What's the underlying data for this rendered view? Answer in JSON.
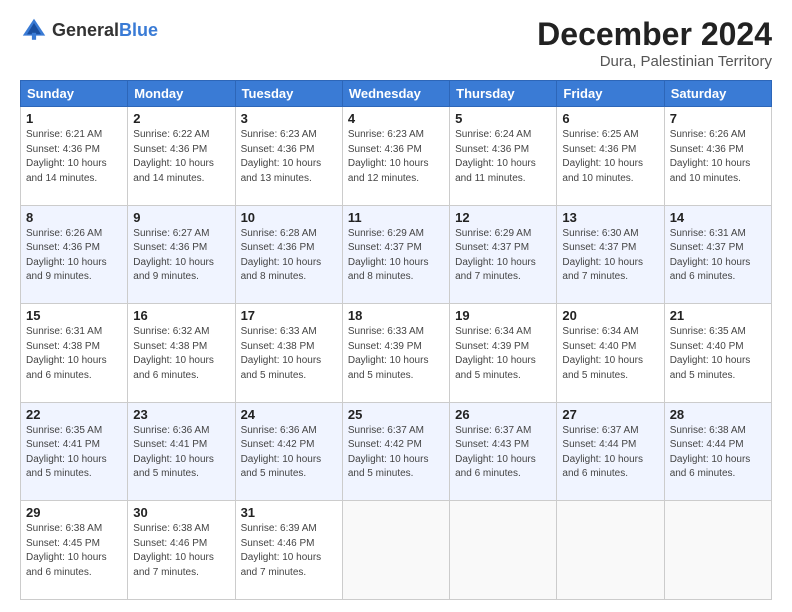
{
  "header": {
    "logo_general": "General",
    "logo_blue": "Blue",
    "month_title": "December 2024",
    "location": "Dura, Palestinian Territory"
  },
  "days_of_week": [
    "Sunday",
    "Monday",
    "Tuesday",
    "Wednesday",
    "Thursday",
    "Friday",
    "Saturday"
  ],
  "weeks": [
    [
      {
        "day": "1",
        "info": "Sunrise: 6:21 AM\nSunset: 4:36 PM\nDaylight: 10 hours\nand 14 minutes."
      },
      {
        "day": "2",
        "info": "Sunrise: 6:22 AM\nSunset: 4:36 PM\nDaylight: 10 hours\nand 14 minutes."
      },
      {
        "day": "3",
        "info": "Sunrise: 6:23 AM\nSunset: 4:36 PM\nDaylight: 10 hours\nand 13 minutes."
      },
      {
        "day": "4",
        "info": "Sunrise: 6:23 AM\nSunset: 4:36 PM\nDaylight: 10 hours\nand 12 minutes."
      },
      {
        "day": "5",
        "info": "Sunrise: 6:24 AM\nSunset: 4:36 PM\nDaylight: 10 hours\nand 11 minutes."
      },
      {
        "day": "6",
        "info": "Sunrise: 6:25 AM\nSunset: 4:36 PM\nDaylight: 10 hours\nand 10 minutes."
      },
      {
        "day": "7",
        "info": "Sunrise: 6:26 AM\nSunset: 4:36 PM\nDaylight: 10 hours\nand 10 minutes."
      }
    ],
    [
      {
        "day": "8",
        "info": "Sunrise: 6:26 AM\nSunset: 4:36 PM\nDaylight: 10 hours\nand 9 minutes."
      },
      {
        "day": "9",
        "info": "Sunrise: 6:27 AM\nSunset: 4:36 PM\nDaylight: 10 hours\nand 9 minutes."
      },
      {
        "day": "10",
        "info": "Sunrise: 6:28 AM\nSunset: 4:36 PM\nDaylight: 10 hours\nand 8 minutes."
      },
      {
        "day": "11",
        "info": "Sunrise: 6:29 AM\nSunset: 4:37 PM\nDaylight: 10 hours\nand 8 minutes."
      },
      {
        "day": "12",
        "info": "Sunrise: 6:29 AM\nSunset: 4:37 PM\nDaylight: 10 hours\nand 7 minutes."
      },
      {
        "day": "13",
        "info": "Sunrise: 6:30 AM\nSunset: 4:37 PM\nDaylight: 10 hours\nand 7 minutes."
      },
      {
        "day": "14",
        "info": "Sunrise: 6:31 AM\nSunset: 4:37 PM\nDaylight: 10 hours\nand 6 minutes."
      }
    ],
    [
      {
        "day": "15",
        "info": "Sunrise: 6:31 AM\nSunset: 4:38 PM\nDaylight: 10 hours\nand 6 minutes."
      },
      {
        "day": "16",
        "info": "Sunrise: 6:32 AM\nSunset: 4:38 PM\nDaylight: 10 hours\nand 6 minutes."
      },
      {
        "day": "17",
        "info": "Sunrise: 6:33 AM\nSunset: 4:38 PM\nDaylight: 10 hours\nand 5 minutes."
      },
      {
        "day": "18",
        "info": "Sunrise: 6:33 AM\nSunset: 4:39 PM\nDaylight: 10 hours\nand 5 minutes."
      },
      {
        "day": "19",
        "info": "Sunrise: 6:34 AM\nSunset: 4:39 PM\nDaylight: 10 hours\nand 5 minutes."
      },
      {
        "day": "20",
        "info": "Sunrise: 6:34 AM\nSunset: 4:40 PM\nDaylight: 10 hours\nand 5 minutes."
      },
      {
        "day": "21",
        "info": "Sunrise: 6:35 AM\nSunset: 4:40 PM\nDaylight: 10 hours\nand 5 minutes."
      }
    ],
    [
      {
        "day": "22",
        "info": "Sunrise: 6:35 AM\nSunset: 4:41 PM\nDaylight: 10 hours\nand 5 minutes."
      },
      {
        "day": "23",
        "info": "Sunrise: 6:36 AM\nSunset: 4:41 PM\nDaylight: 10 hours\nand 5 minutes."
      },
      {
        "day": "24",
        "info": "Sunrise: 6:36 AM\nSunset: 4:42 PM\nDaylight: 10 hours\nand 5 minutes."
      },
      {
        "day": "25",
        "info": "Sunrise: 6:37 AM\nSunset: 4:42 PM\nDaylight: 10 hours\nand 5 minutes."
      },
      {
        "day": "26",
        "info": "Sunrise: 6:37 AM\nSunset: 4:43 PM\nDaylight: 10 hours\nand 6 minutes."
      },
      {
        "day": "27",
        "info": "Sunrise: 6:37 AM\nSunset: 4:44 PM\nDaylight: 10 hours\nand 6 minutes."
      },
      {
        "day": "28",
        "info": "Sunrise: 6:38 AM\nSunset: 4:44 PM\nDaylight: 10 hours\nand 6 minutes."
      }
    ],
    [
      {
        "day": "29",
        "info": "Sunrise: 6:38 AM\nSunset: 4:45 PM\nDaylight: 10 hours\nand 6 minutes."
      },
      {
        "day": "30",
        "info": "Sunrise: 6:38 AM\nSunset: 4:46 PM\nDaylight: 10 hours\nand 7 minutes."
      },
      {
        "day": "31",
        "info": "Sunrise: 6:39 AM\nSunset: 4:46 PM\nDaylight: 10 hours\nand 7 minutes."
      },
      null,
      null,
      null,
      null
    ]
  ]
}
